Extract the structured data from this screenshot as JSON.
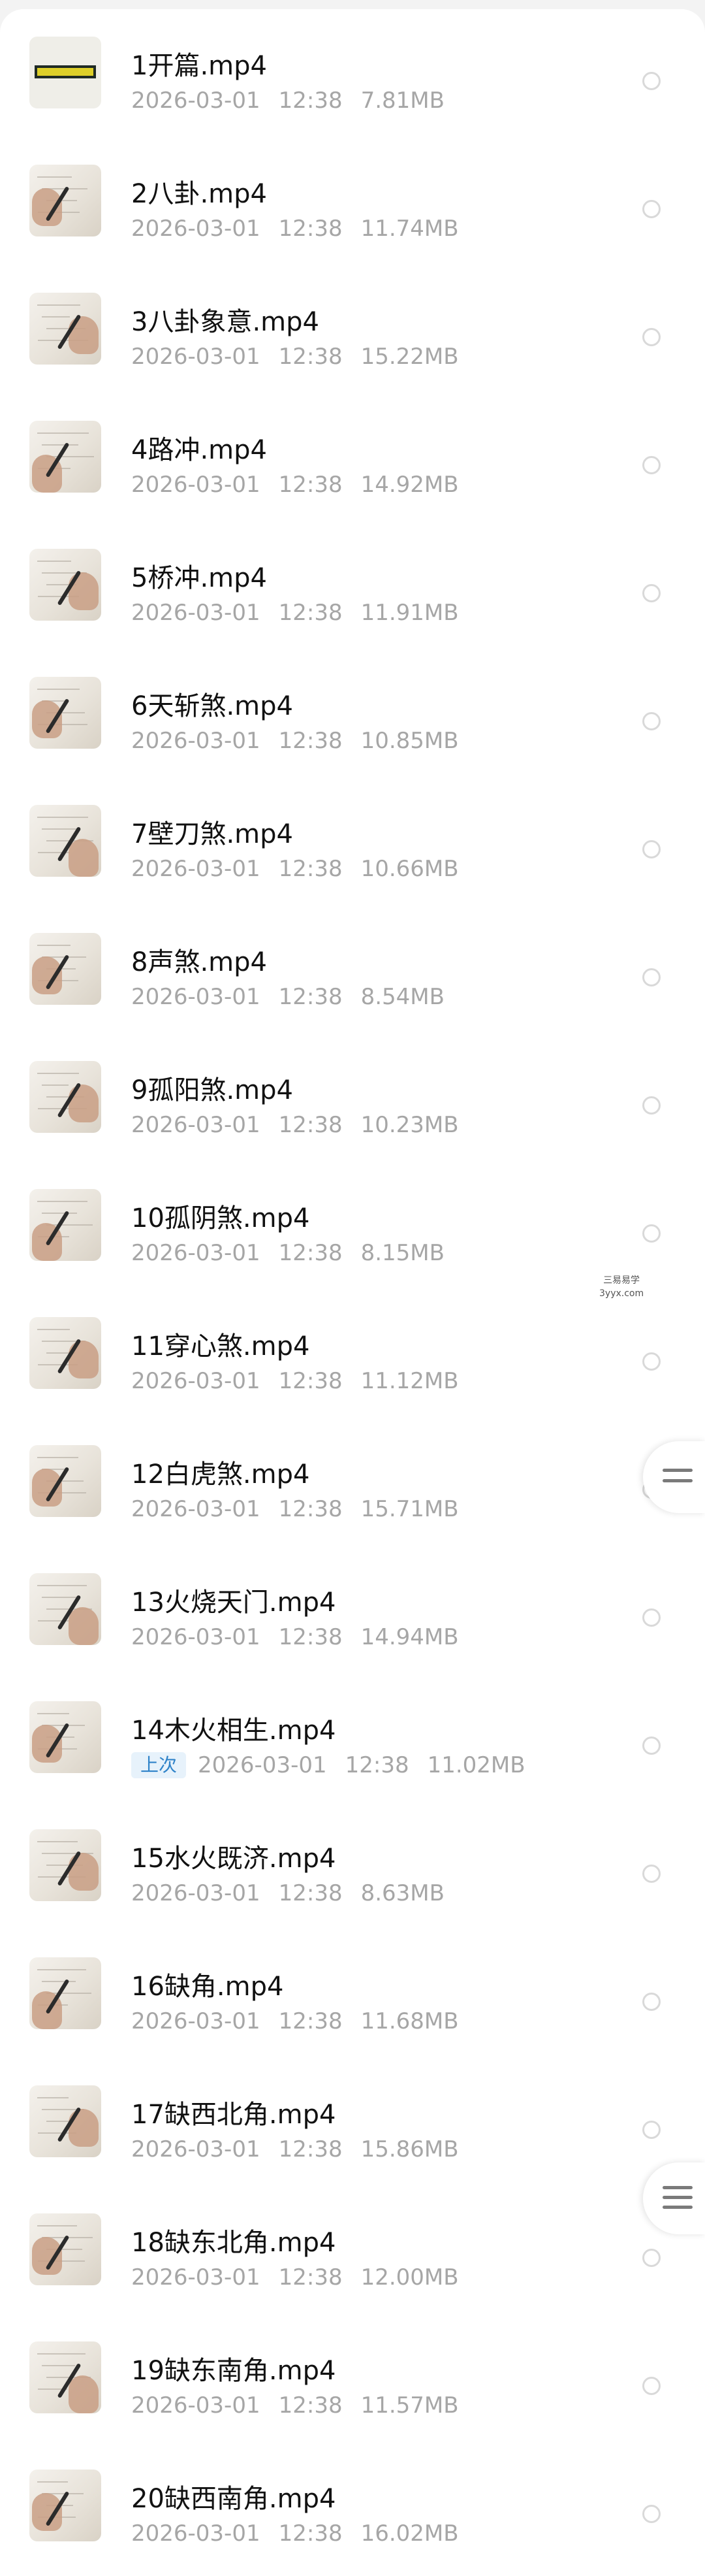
{
  "files": [
    {
      "name": "1开篇.mp4",
      "date": "2026-03-01",
      "time": "12:38",
      "size": "7.81MB",
      "badge": ""
    },
    {
      "name": "2八卦.mp4",
      "date": "2026-03-01",
      "time": "12:38",
      "size": "11.74MB",
      "badge": ""
    },
    {
      "name": "3八卦象意.mp4",
      "date": "2026-03-01",
      "time": "12:38",
      "size": "15.22MB",
      "badge": ""
    },
    {
      "name": "4路冲.mp4",
      "date": "2026-03-01",
      "time": "12:38",
      "size": "14.92MB",
      "badge": ""
    },
    {
      "name": "5桥冲.mp4",
      "date": "2026-03-01",
      "time": "12:38",
      "size": "11.91MB",
      "badge": ""
    },
    {
      "name": "6天斩煞.mp4",
      "date": "2026-03-01",
      "time": "12:38",
      "size": "10.85MB",
      "badge": ""
    },
    {
      "name": "7壁刀煞.mp4",
      "date": "2026-03-01",
      "time": "12:38",
      "size": "10.66MB",
      "badge": ""
    },
    {
      "name": "8声煞.mp4",
      "date": "2026-03-01",
      "time": "12:38",
      "size": "8.54MB",
      "badge": ""
    },
    {
      "name": "9孤阳煞.mp4",
      "date": "2026-03-01",
      "time": "12:38",
      "size": "10.23MB",
      "badge": ""
    },
    {
      "name": "10孤阴煞.mp4",
      "date": "2026-03-01",
      "time": "12:38",
      "size": "8.15MB",
      "badge": ""
    },
    {
      "name": "11穿心煞.mp4",
      "date": "2026-03-01",
      "time": "12:38",
      "size": "11.12MB",
      "badge": ""
    },
    {
      "name": "12白虎煞.mp4",
      "date": "2026-03-01",
      "time": "12:38",
      "size": "15.71MB",
      "badge": ""
    },
    {
      "name": "13火烧天门.mp4",
      "date": "2026-03-01",
      "time": "12:38",
      "size": "14.94MB",
      "badge": ""
    },
    {
      "name": "14木火相生.mp4",
      "date": "2026-03-01",
      "time": "12:38",
      "size": "11.02MB",
      "badge": "上次"
    },
    {
      "name": "15水火既济.mp4",
      "date": "2026-03-01",
      "time": "12:38",
      "size": "8.63MB",
      "badge": ""
    },
    {
      "name": "16缺角.mp4",
      "date": "2026-03-01",
      "time": "12:38",
      "size": "11.68MB",
      "badge": ""
    },
    {
      "name": "17缺西北角.mp4",
      "date": "2026-03-01",
      "time": "12:38",
      "size": "15.86MB",
      "badge": ""
    },
    {
      "name": "18缺东北角.mp4",
      "date": "2026-03-01",
      "time": "12:38",
      "size": "12.00MB",
      "badge": ""
    },
    {
      "name": "19缺东南角.mp4",
      "date": "2026-03-01",
      "time": "12:38",
      "size": "11.57MB",
      "badge": ""
    },
    {
      "name": "20缺西南角.mp4",
      "date": "2026-03-01",
      "time": "12:38",
      "size": "16.02MB",
      "badge": ""
    }
  ],
  "side_tabs": [
    {
      "icon": "menu-icon"
    },
    {
      "icon": "menu-icon"
    }
  ],
  "watermark": {
    "line1": "三易易学",
    "line2": "3yyx.com"
  }
}
